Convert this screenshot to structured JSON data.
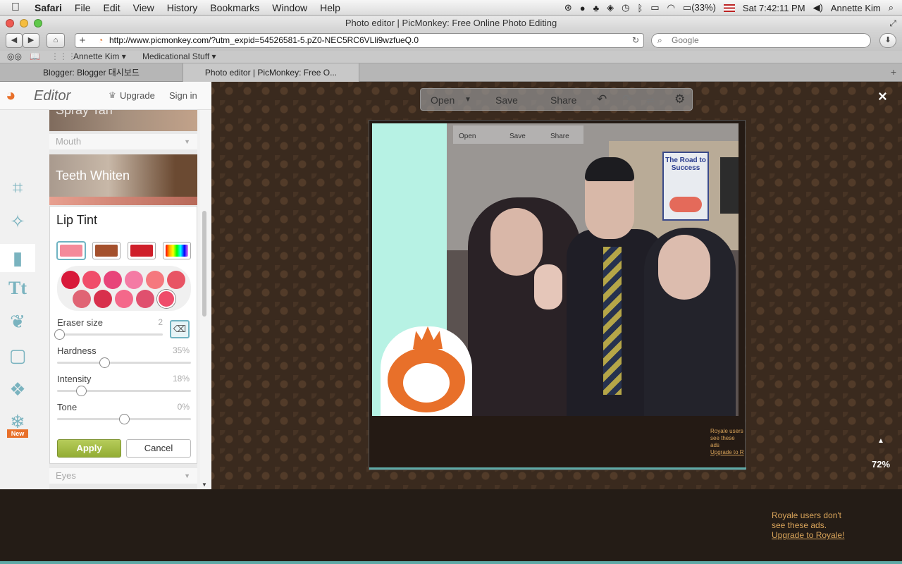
{
  "menubar": {
    "app": "Safari",
    "items": [
      "File",
      "Edit",
      "View",
      "History",
      "Bookmarks",
      "Window",
      "Help"
    ],
    "battery": "(33%)",
    "clock": "Sat 7:42:11 PM",
    "user": "Annette Kim"
  },
  "window": {
    "title": "Photo editor | PicMonkey: Free Online Photo Editing"
  },
  "toolbar": {
    "back": "◀",
    "forward": "▶",
    "add": "+",
    "url": "http://www.picmonkey.com/?utm_expid=54526581-5.pZ0-NEC5RC6VLli9wzfueQ.0",
    "search_placeholder": "Google"
  },
  "bookmarks": [
    "Annette Kim ▾",
    "Medicational Stuff ▾"
  ],
  "tabs": [
    {
      "label": "Blogger: Blogger 대시보드"
    },
    {
      "label": "Photo editor | PicMonkey: Free O..."
    }
  ],
  "editor": {
    "brand": "Editor",
    "upgrade": "Upgrade",
    "sign_in": "Sign in",
    "sections": {
      "spray": "Spray Tan",
      "mouth": "Mouth",
      "teeth": "Teeth Whiten",
      "eyes": "Eyes"
    },
    "tool_new_badge": "New",
    "lip_tint": {
      "title": "Lip Tint",
      "swatch_colors": [
        "#f48a9a",
        "#a4502c",
        "#cf1f2a"
      ],
      "dot_colors": [
        "#d8193a",
        "#f04d6a",
        "#e8447a",
        "#f47aa4",
        "#f5787e",
        "#e85464",
        "#e06474",
        "#d8304c",
        "#f4688a",
        "#e0506e",
        "#ef4c6a"
      ],
      "eraser": {
        "label": "Eraser size",
        "value": "2",
        "fraction": 0.02
      },
      "hardness": {
        "label": "Hardness",
        "value": "35%",
        "fraction": 0.35
      },
      "intensity": {
        "label": "Intensity",
        "value": "18%",
        "fraction": 0.18
      },
      "tone": {
        "label": "Tone",
        "value": "0%",
        "fraction": 0.5
      },
      "apply": "Apply",
      "cancel": "Cancel"
    }
  },
  "actions": {
    "open": "Open",
    "save": "Save",
    "share": "Share"
  },
  "inner_actions": {
    "open": "Open",
    "save": "Save",
    "share": "Share"
  },
  "photo": {
    "poster_title": "The Road to Success"
  },
  "ads": {
    "small": [
      "Royale users",
      "see these ads",
      "Upgrade to R"
    ],
    "big_line1": "Royale users don't",
    "big_line2": "see these ads.",
    "big_link": "Upgrade to Royale!"
  },
  "zoom": "72%",
  "close": "×"
}
